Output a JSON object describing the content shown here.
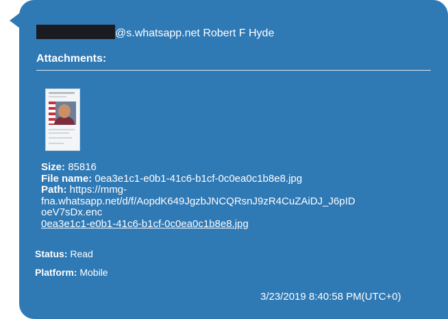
{
  "message": {
    "sender_suffix": "@s.whatsapp.net Robert F Hyde",
    "attachments_label": "Attachments:",
    "attachment": {
      "size_label": "Size:",
      "size_value": "85816",
      "file_name_label": "File name:",
      "file_name_value": "0ea3e1c1-e0b1-41c6-b1cf-0c0ea0c1b8e8.jpg",
      "path_label": "Path:",
      "path_line1": "https://mmg-",
      "path_line2": "fna.whatsapp.net/d/f/AopdK649JgzbJNCQRsnJ9zR4CuZAiDJ_J6pID",
      "path_line3": "oeV7sDx.enc",
      "link_text": "0ea3e1c1-e0b1-41c6-b1cf-0c0ea0c1b8e8.jpg"
    },
    "status_label": "Status:",
    "status_value": "Read",
    "platform_label": "Platform:",
    "platform_value": "Mobile",
    "timestamp": "3/23/2019 8:40:58 PM(UTC+0)"
  },
  "colors": {
    "bubble": "#2f79b5",
    "text": "#ffffff",
    "redaction": "#1a1c22"
  }
}
